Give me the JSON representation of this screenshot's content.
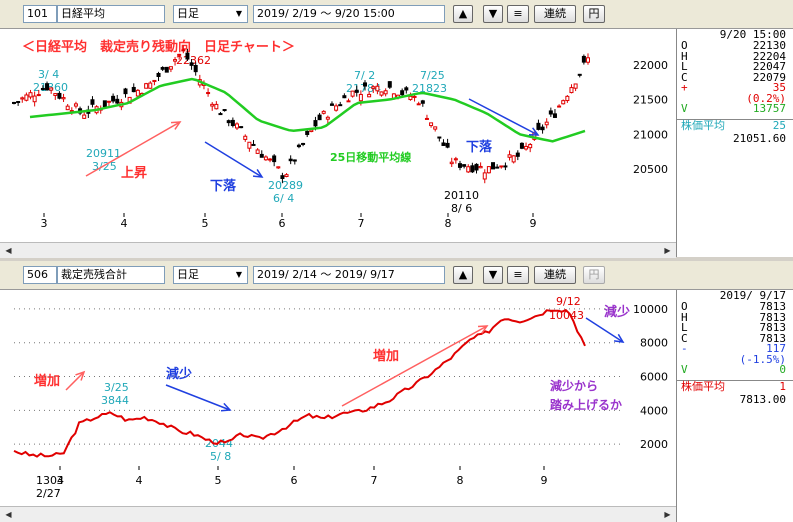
{
  "top": {
    "code": "101",
    "name": "日経平均",
    "period": "日足",
    "range": "2019/ 2/19 ～  9/20 15:00",
    "buttons": {
      "up": "▲",
      "down": "▼",
      "menu": "≡",
      "continuous": "連続",
      "yen": "円"
    },
    "title_annotation": "＜日経平均　裁定売り残動向　日足チャート＞",
    "price_axis": [
      "22000",
      "21500",
      "21000",
      "20500"
    ],
    "month_labels": [
      "3",
      "4",
      "5",
      "6",
      "7",
      "8",
      "9"
    ],
    "annotations": {
      "a1_date": "3/ 4",
      "a1_val": "21860",
      "a2_val": "22362",
      "a3_date": "7/ 2",
      "a3_val": "21784",
      "a4_date": "7/25",
      "a4_val": "21823",
      "a5_val": "20911",
      "a5_date": "3/25",
      "a6_val": "20289",
      "a6_date": "6/ 4",
      "a7_val": "20110",
      "a7_date": "8/ 6",
      "rise": "上昇",
      "fall1": "下落",
      "fall2": "下落",
      "ma_label": "25日移動平均線"
    },
    "info": {
      "time": "9/20 15:00",
      "O": "22130",
      "H": "22204",
      "L": "22047",
      "C": "22079",
      "change_sign": "+",
      "change": "35",
      "change_pct": "(0.2%)",
      "V": "13757",
      "avg_label": "株価平均",
      "avg_n": "25",
      "avg_val": "21051.60"
    },
    "colors": {
      "up": "#e00000",
      "down": "#000000",
      "ma": "#22cc22",
      "cyan": "#20a8b8",
      "annot": "#ff3030",
      "blue": "#2040e0"
    }
  },
  "bottom": {
    "code": "506",
    "name": "裁定売残合計",
    "period": "日足",
    "range": "2019/ 2/14 ～  2019/ 9/17",
    "buttons": {
      "up": "▲",
      "down": "▼",
      "menu": "≡",
      "continuous": "連続",
      "yen": "円"
    },
    "value_axis": [
      "10000",
      "8000",
      "6000",
      "4000",
      "2000"
    ],
    "month_labels": [
      "3",
      "4",
      "5",
      "6",
      "7",
      "8",
      "9"
    ],
    "annotations": {
      "b1_val": "1304",
      "b1_date": "2/27",
      "b2_date": "3/25",
      "b2_val": "3844",
      "b3_val": "2044",
      "b3_date": "5/ 8",
      "b4_date": "9/12",
      "b4_val": "10043",
      "increase1": "増加",
      "decrease1": "減少",
      "increase2": "増加",
      "decrease2": "減少",
      "note_line1": "減少から",
      "note_line2": "踏み上げるか"
    },
    "info": {
      "date": "2019/ 9/17",
      "O": "7813",
      "H": "7813",
      "L": "7813",
      "C": "7813",
      "change_sign": "-",
      "change": "117",
      "change_pct": "(-1.5%)",
      "V": "0",
      "avg_label": "株価平均",
      "avg_n": "1",
      "avg_val": "7813.00"
    },
    "colors": {
      "line": "#e00000",
      "purple": "#9933cc"
    }
  },
  "chart_data": [
    {
      "type": "candlestick",
      "title": "＜日経平均　裁定売り残動向　日足チャート＞",
      "ylim": [
        20000,
        22400
      ],
      "x_months": [
        "3",
        "4",
        "5",
        "6",
        "7",
        "8",
        "9"
      ],
      "series": [
        {
          "name": "25日移動平均線",
          "values": [
            21250,
            21300,
            21350,
            21450,
            21700,
            21800,
            21600,
            21200,
            21050,
            21100,
            21450,
            21500,
            21600,
            21500,
            21300,
            21000,
            20900,
            21050
          ]
        },
        {
          "name": "close",
          "values": [
            21450,
            21700,
            21300,
            21500,
            21700,
            22200,
            21400,
            20900,
            20400,
            21200,
            21600,
            21700,
            21500,
            20600,
            20500,
            20700,
            21300,
            22080
          ]
        }
      ],
      "annotated_points": [
        {
          "date": "3/ 4",
          "value": 21860
        },
        {
          "value": 22362
        },
        {
          "date": "7/ 2",
          "value": 21784
        },
        {
          "date": "7/25",
          "value": 21823
        },
        {
          "date": "3/25",
          "value": 20911
        },
        {
          "date": "6/ 4",
          "value": 20289
        },
        {
          "date": "8/ 6",
          "value": 20110
        }
      ]
    },
    {
      "type": "line",
      "ylim": [
        0,
        11000
      ],
      "x_months": [
        "3",
        "4",
        "5",
        "6",
        "7",
        "8",
        "9"
      ],
      "series": [
        {
          "values": [
            1600,
            1350,
            1304,
            1400,
            3200,
            3600,
            3844,
            3400,
            3600,
            3300,
            2800,
            2600,
            2200,
            2044,
            2600,
            2300,
            2700,
            3200,
            3700,
            3500,
            3800,
            3900,
            4200,
            4600,
            5200,
            5800,
            6500,
            7300,
            8200,
            8600,
            9500,
            9300,
            9600,
            10043,
            9900,
            7813
          ]
        }
      ],
      "annotated_points": [
        {
          "date": "2/27",
          "value": 1304
        },
        {
          "date": "3/25",
          "value": 3844
        },
        {
          "date": "5/ 8",
          "value": 2044
        },
        {
          "date": "9/12",
          "value": 10043
        }
      ]
    }
  ]
}
